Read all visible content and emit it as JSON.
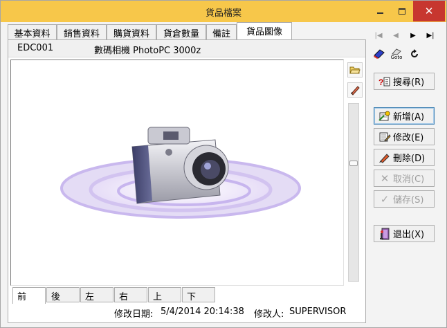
{
  "window": {
    "title": "貨品檔案",
    "close_glyph": "✕"
  },
  "tabs": [
    {
      "label": "基本資料"
    },
    {
      "label": "銷售資料"
    },
    {
      "label": "購貨資料"
    },
    {
      "label": "貨倉數量"
    },
    {
      "label": "備註"
    },
    {
      "label": "貨品圖像",
      "active": true
    }
  ],
  "product": {
    "code": "EDC001",
    "name": "數碼相機 PhotoPC 3000z"
  },
  "view_tabs": [
    {
      "label": "前",
      "active": true
    },
    {
      "label": "後"
    },
    {
      "label": "左"
    },
    {
      "label": "右"
    },
    {
      "label": "上"
    },
    {
      "label": "下"
    }
  ],
  "footer": {
    "modified_date_label": "修改日期:",
    "modified_date": "5/4/2014 20:14:38",
    "modified_by_label": "修改人:",
    "modified_by": "SUPERVISOR"
  },
  "nav": {
    "first": "|◀",
    "prev": "◀",
    "next": "▶",
    "last": "▶|"
  },
  "goto_label": "Goto",
  "buttons": {
    "search": "搜尋(R)",
    "add": "新增(A)",
    "edit": "修改(E)",
    "delete": "刪除(D)",
    "cancel": "取消(C)",
    "save": "儲存(S)",
    "exit": "退出(X)"
  },
  "colors": {
    "titlebar": "#f7c74a",
    "close": "#c7372f",
    "focus": "#3c7fb1"
  },
  "icons": [
    "minimize-icon",
    "maximize-icon",
    "close-icon",
    "folder-open-icon",
    "edit-pencil-icon",
    "first-record-icon",
    "prev-record-icon",
    "next-record-icon",
    "last-record-icon",
    "eraser-icon",
    "goto-icon",
    "refresh-icon",
    "search-icon",
    "add-icon",
    "edit-icon",
    "delete-icon",
    "cancel-icon",
    "save-icon",
    "exit-icon"
  ]
}
